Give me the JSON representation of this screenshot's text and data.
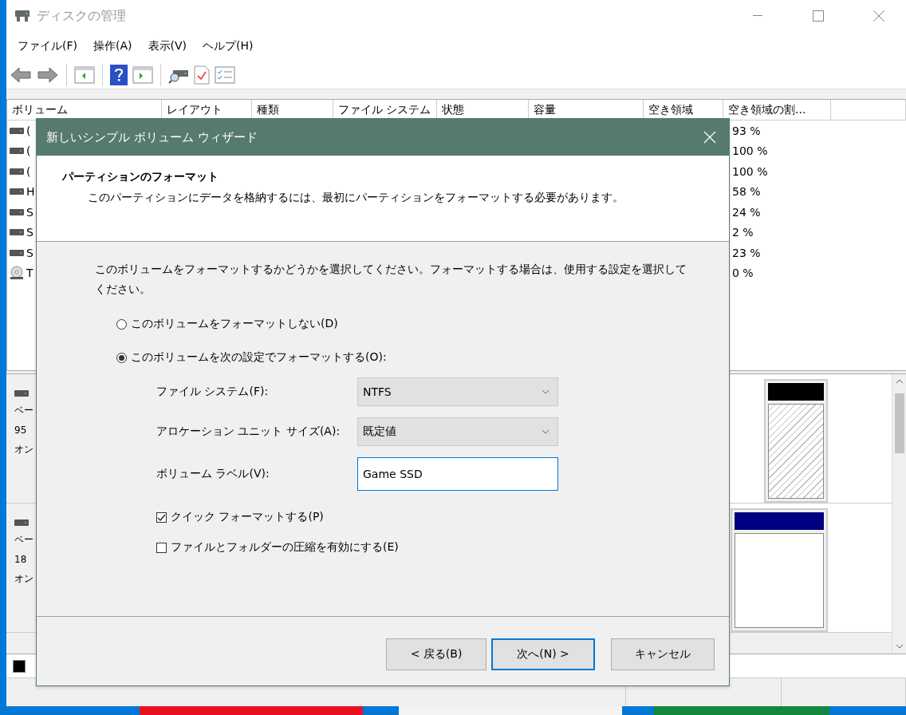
{
  "window": {
    "title": "ディスクの管理"
  },
  "menu": [
    "ファイル(F)",
    "操作(A)",
    "表示(V)",
    "ヘルプ(H)"
  ],
  "volume_list": {
    "columns": [
      "ボリューム",
      "レイアウト",
      "種類",
      "ファイル システム",
      "状態",
      "容量",
      "空き領域",
      "空き領域の割..."
    ],
    "rows": [
      {
        "kind": "disk",
        "volume": "(",
        "free_percent": "93 %"
      },
      {
        "kind": "disk",
        "volume": "(",
        "free_percent": "100 %"
      },
      {
        "kind": "disk",
        "volume": "(",
        "free_percent": "100 %"
      },
      {
        "kind": "disk",
        "volume": "H",
        "free_percent": "58 %"
      },
      {
        "kind": "disk",
        "volume": "S",
        "free_percent": "24 %"
      },
      {
        "kind": "disk",
        "volume": "S",
        "free_percent": "2 %"
      },
      {
        "kind": "disk",
        "volume": "S",
        "free_percent": "23 %"
      },
      {
        "kind": "cdrom",
        "volume": "T",
        "free_percent": "0 %"
      }
    ]
  },
  "disks": [
    {
      "lines": [
        "ベー",
        "95",
        "オン"
      ],
      "partition": {
        "color": "#000000",
        "kind": "hatched"
      }
    },
    {
      "lines": [
        "ベー",
        "18",
        "オン"
      ],
      "partition": {
        "color": "#000080",
        "kind": "plain"
      }
    }
  ],
  "wizard": {
    "title": "新しいシンプル ボリューム ウィザード",
    "heading": "パーティションのフォーマット",
    "subheading": "このパーティションにデータを格納するには、最初にパーティションをフォーマットする必要があります。",
    "instruction": "このボリュームをフォーマットするかどうかを選択してください。フォーマットする場合は、使用する設定を選択してください。",
    "options": [
      {
        "label": "このボリュームをフォーマットしない(D)",
        "selected": false
      },
      {
        "label": "このボリュームを次の設定でフォーマットする(O):",
        "selected": true
      }
    ],
    "fields": [
      {
        "kind": "dropdown",
        "label": "ファイル システム(F):",
        "value": "NTFS"
      },
      {
        "kind": "dropdown",
        "label": "アロケーション ユニット サイズ(A):",
        "value": "既定値"
      },
      {
        "kind": "text",
        "label": "ボリューム ラベル(V):",
        "value": "Game SSD"
      }
    ],
    "checkboxes": [
      {
        "label": "クイック フォーマットする(P)",
        "checked": true
      },
      {
        "label": "ファイルとフォルダーの圧縮を有効にする(E)",
        "checked": false
      }
    ],
    "buttons": [
      {
        "label": "< 戻る(B)",
        "default": false
      },
      {
        "label": "次へ(N) >",
        "default": true
      },
      {
        "label": "キャンセル",
        "default": false
      }
    ]
  }
}
